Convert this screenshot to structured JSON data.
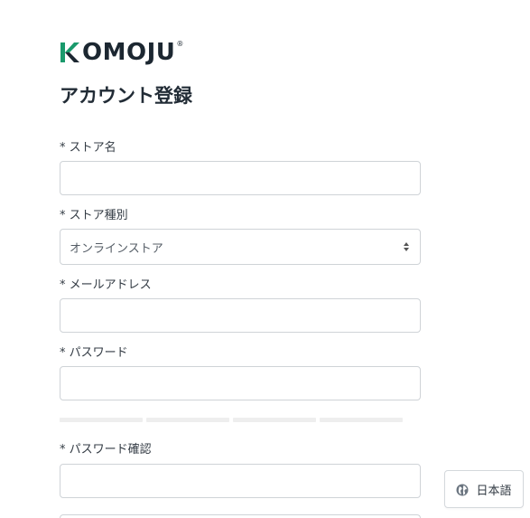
{
  "brand": {
    "name": "KOMOJU",
    "registered_mark": "®",
    "accent_color": "#1a9a6c",
    "text_color": "#1c2731"
  },
  "page": {
    "title": "アカウント登録"
  },
  "form": {
    "store_name": {
      "label": "* ストア名",
      "value": "",
      "placeholder": ""
    },
    "store_type": {
      "label": "* ストア種別",
      "selected": "オンラインストア"
    },
    "email": {
      "label": "* メールアドレス",
      "value": "",
      "placeholder": ""
    },
    "password": {
      "label": "* パスワード",
      "value": "",
      "placeholder": "",
      "strength_segments": 4,
      "strength_level": 0
    },
    "password_confirm": {
      "label": "* パスワード確認",
      "value": "",
      "placeholder": ""
    }
  },
  "language_switcher": {
    "icon": "globe-icon",
    "label": "日本語"
  }
}
